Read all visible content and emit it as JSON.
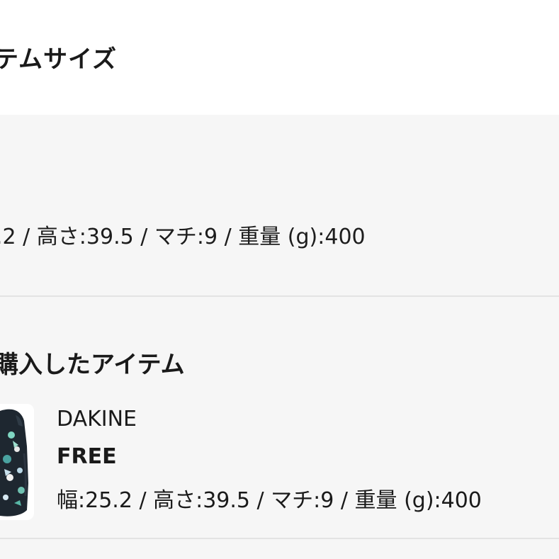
{
  "header": {
    "title": "テムサイズ"
  },
  "size_section": {
    "dimensions_text": ".2 / 高さ:39.5 / マチ:9 / 重量 (g):400"
  },
  "purchased_section": {
    "title": "購入したアイテム",
    "item": {
      "brand": "DAKINE",
      "size": "FREE",
      "dimensions": "幅:25.2 / 高さ:39.5 / マチ:9 / 重量 (g):400"
    }
  },
  "colors": {
    "panel_background": "#f6f6f6",
    "divider": "#e3e3e3",
    "text": "#1a1a1a"
  }
}
